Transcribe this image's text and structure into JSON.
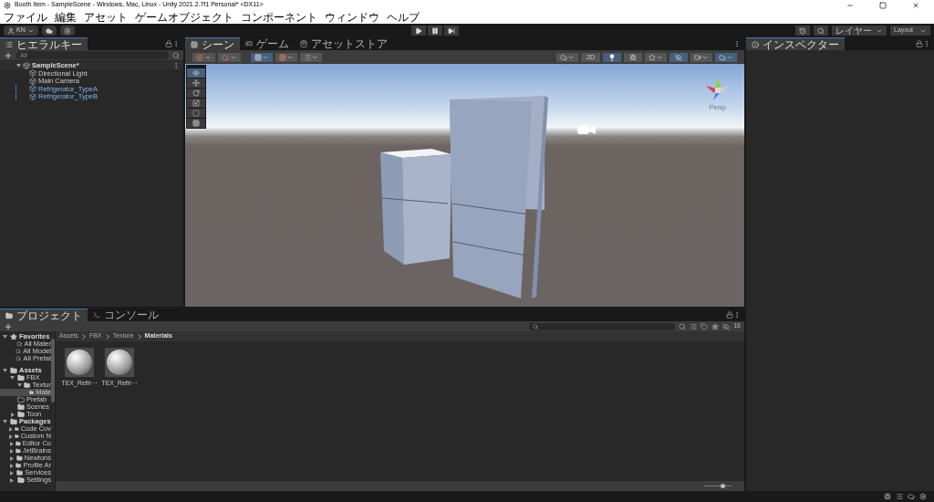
{
  "window": {
    "title": "Booth Item - SampleScene - Windows, Mac, Linux - Unity 2021.2.7f1 Personal* <DX11>"
  },
  "menu": [
    "ファイル",
    "編集",
    "アセット",
    "ゲームオブジェクト",
    "コンポーネント",
    "ウィンドウ",
    "ヘルプ"
  ],
  "toolbar": {
    "account": "KN",
    "layers": "レイヤー",
    "layout": "Layout"
  },
  "hierarchy": {
    "tab": "ヒエラルキー",
    "search_placeholder": "All",
    "scene": "SampleScene*",
    "items": [
      {
        "label": "Directional Light",
        "kind": "object"
      },
      {
        "label": "Main Camera",
        "kind": "object"
      },
      {
        "label": "Refrigerator_TypeA",
        "kind": "prefab"
      },
      {
        "label": "Refrigerator_TypeB",
        "kind": "prefab"
      }
    ]
  },
  "scene_tabs": [
    {
      "label": "シーン",
      "selected": true
    },
    {
      "label": "ゲーム",
      "selected": false
    },
    {
      "label": "アセットストア",
      "selected": false
    }
  ],
  "scene_toolbar": {
    "mode_2d": "2D",
    "mode_2d_on": false,
    "lighting_on": true
  },
  "tools": [
    {
      "kind": "view",
      "selected": true
    },
    {
      "kind": "move",
      "selected": false
    },
    {
      "kind": "rotate",
      "selected": false
    },
    {
      "kind": "scale",
      "selected": false
    },
    {
      "kind": "rect",
      "selected": false
    },
    {
      "kind": "transform",
      "selected": false
    }
  ],
  "gizmo": {
    "label": "Persp"
  },
  "project_tabs": [
    {
      "label": "プロジェクト",
      "selected": true
    },
    {
      "label": "コンソール",
      "selected": false
    }
  ],
  "project_tree": [
    {
      "label": "Favorites",
      "kind": "favorites",
      "expanded": true,
      "selected": false,
      "children": [
        {
          "label": "All Mater",
          "kind": "search",
          "selected": false
        },
        {
          "label": "All Model",
          "kind": "search",
          "selected": false
        },
        {
          "label": "All Prefat",
          "kind": "search",
          "selected": false
        }
      ]
    },
    {
      "label": "Assets",
      "kind": "folder",
      "expanded": true,
      "selected": false,
      "children": [
        {
          "label": "FBX",
          "kind": "folder",
          "expanded": true,
          "selected": false,
          "children": [
            {
              "label": "Textur",
              "kind": "folder",
              "expanded": true,
              "selected": false,
              "children": [
                {
                  "label": "Mate",
                  "kind": "folder",
                  "selected": true
                }
              ]
            }
          ]
        },
        {
          "label": "Prefab",
          "kind": "empty",
          "selected": false
        },
        {
          "label": "Scenes",
          "kind": "folder",
          "selected": false
        },
        {
          "label": "Toon",
          "kind": "folder",
          "expanded": false,
          "selected": false
        }
      ]
    },
    {
      "label": "Packages",
      "kind": "folder",
      "expanded": true,
      "selected": false,
      "children": [
        {
          "label": "Code Cov",
          "kind": "folder",
          "expanded": false,
          "selected": false
        },
        {
          "label": "Custom N",
          "kind": "folder",
          "expanded": false,
          "selected": false
        },
        {
          "label": "Editor Co",
          "kind": "folder",
          "expanded": false,
          "selected": false
        },
        {
          "label": "JetBrains",
          "kind": "folder",
          "expanded": false,
          "selected": false
        },
        {
          "label": "Newtons",
          "kind": "folder",
          "expanded": false,
          "selected": false
        },
        {
          "label": "Profile Ar",
          "kind": "folder",
          "expanded": false,
          "selected": false
        },
        {
          "label": "Services",
          "kind": "folder",
          "expanded": false,
          "selected": false
        },
        {
          "label": "Settings",
          "kind": "folder",
          "expanded": false,
          "selected": false
        }
      ]
    }
  ],
  "breadcrumb": [
    "Assets",
    "FBX",
    "Texture",
    "Materials"
  ],
  "assets": [
    {
      "label": "TEX_Refri···"
    },
    {
      "label": "TEX_Refri···"
    }
  ],
  "hidden_count": "16",
  "zoom": {
    "level": 0.7
  },
  "inspector": {
    "tab": "インスペクター"
  }
}
